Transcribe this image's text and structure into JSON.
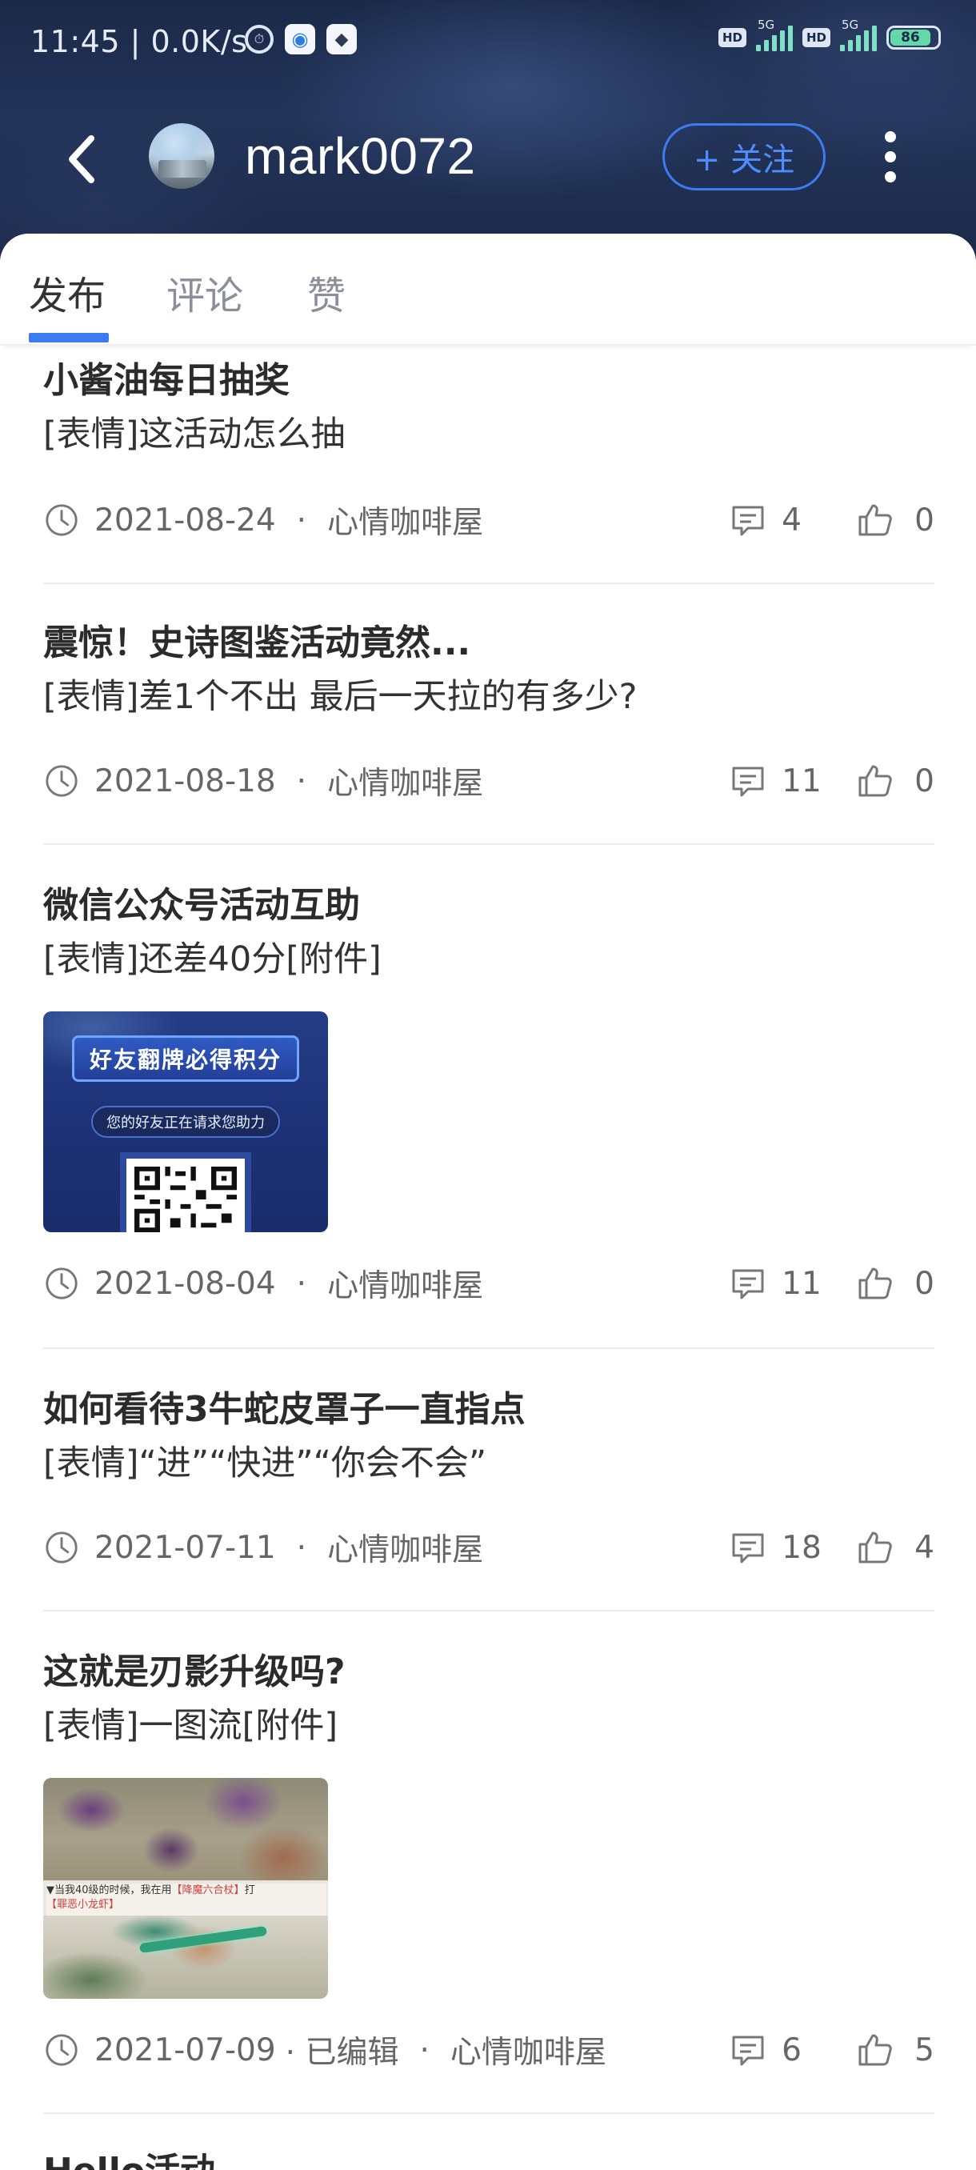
{
  "status_bar": {
    "time": "11:45 | 0.0K/s",
    "hd1": "HD",
    "hd2": "HD",
    "net1": "5G",
    "net2": "5G",
    "battery": "86",
    "battery_level_percent": 86
  },
  "header": {
    "username": "mark0072",
    "follow_label": "+ 关注"
  },
  "tabs": [
    {
      "label": "发布",
      "active": true
    },
    {
      "label": "评论",
      "active": false
    },
    {
      "label": "赞",
      "active": false
    }
  ],
  "posts": [
    {
      "title": "小酱油每日抽奖",
      "body": "[表情]这活动怎么抽",
      "date": "2021-08-24",
      "edited": "",
      "board": "心情咖啡屋",
      "comments": "4",
      "likes": "0"
    },
    {
      "title": "震惊！史诗图鉴活动竟然...",
      "body": "[表情]差1个不出 最后一天拉的有多少?",
      "date": "2021-08-18",
      "edited": "",
      "board": "心情咖啡屋",
      "comments": "11",
      "likes": "0"
    },
    {
      "title": "微信公众号活动互助",
      "body": "[表情]还差40分[附件]",
      "image": {
        "banner": "好友翻牌必得积分",
        "sub": "您的好友正在请求您助力"
      },
      "date": "2021-08-04",
      "edited": "",
      "board": "心情咖啡屋",
      "comments": "11",
      "likes": "0"
    },
    {
      "title": "如何看待3牛蛇皮罩子一直指点",
      "body": "[表情]“进”“快进”“你会不会”",
      "date": "2021-07-11",
      "edited": "",
      "board": "心情咖啡屋",
      "comments": "18",
      "likes": "4"
    },
    {
      "title": "这就是刃影升级吗?",
      "body": " [表情]一图流[附件]",
      "image": {
        "caption_prefix": "▼当我40级的时候，我在用",
        "caption_red1": "【降魔六合杖】",
        "caption_mid": "打",
        "caption_red2": "【罪恶小龙虾】"
      },
      "date": "2021-07-09",
      "edited": "· 已编辑",
      "board": "心情咖啡屋",
      "comments": "6",
      "likes": "5"
    },
    {
      "title": "Hello活动"
    }
  ],
  "meta_dot": "·",
  "icons": {
    "back": "back-arrow-icon",
    "more": "more-vertical-icon",
    "clock": "clock-icon",
    "comment": "comment-icon",
    "like": "thumbs-up-icon"
  },
  "colors": {
    "accent": "#3d7bf0",
    "header_bg": "#1f2e50",
    "text": "#333333",
    "meta": "#666666"
  }
}
